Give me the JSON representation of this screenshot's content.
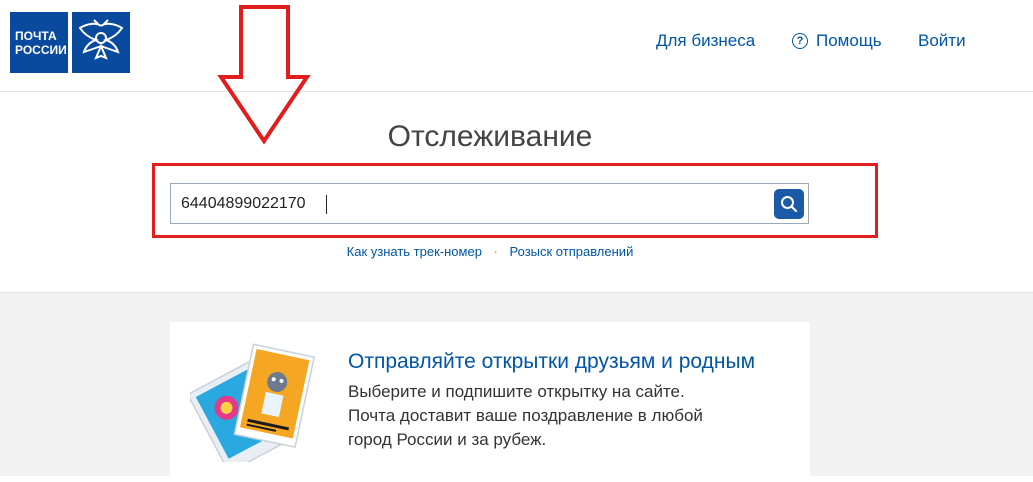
{
  "header": {
    "logo_line1": "ПОЧТА",
    "logo_line2": "РОССИИ",
    "nav_business": "Для бизнеса",
    "nav_help": "Помощь",
    "nav_login": "Войти",
    "help_glyph": "?"
  },
  "main": {
    "title": "Отслеживание",
    "search_value": "64404899022170",
    "link_track": "Как узнать трек-номер",
    "link_separator": "·",
    "link_search": "Розыск отправлений"
  },
  "promo": {
    "title": "Отправляйте открытки друзьям и родным",
    "line1": "Выберите и подпишите открытку на сайте.",
    "line2": "Почта доставит ваше поздравление в любой",
    "line3": "город России и за рубеж."
  },
  "colors": {
    "brand_blue": "#0a4a9e",
    "link_blue": "#0055a6",
    "highlight_red": "#e11d1d"
  }
}
